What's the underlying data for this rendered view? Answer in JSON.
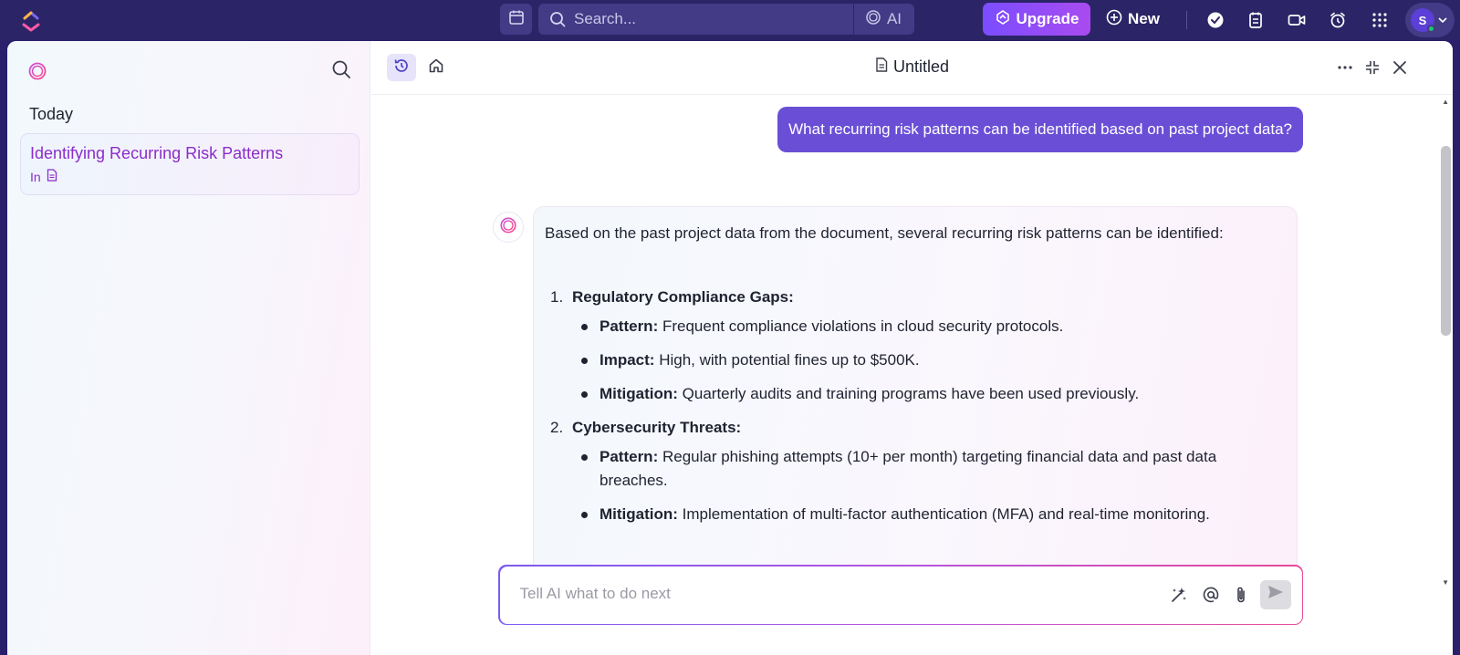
{
  "topbar": {
    "search_placeholder": "Search...",
    "ai_label": "AI",
    "upgrade_label": "Upgrade",
    "new_label": "New",
    "avatar_initial": "S"
  },
  "sidebar": {
    "section_today": "Today",
    "conversation": {
      "title": "Identifying Recurring Risk Patterns",
      "location_prefix": "In"
    }
  },
  "document": {
    "title": "Untitled"
  },
  "chat": {
    "user_message": "What recurring risk patterns can be identified based on past project data?",
    "ai_intro": "Based on the past project data from the document, several recurring risk patterns can be identified:",
    "items": [
      {
        "number": "1.",
        "heading": "Regulatory Compliance Gaps:",
        "bullets": [
          {
            "label": "Pattern:",
            "text": " Frequent compliance violations in cloud security protocols."
          },
          {
            "label": "Impact:",
            "text": " High, with potential fines up to $500K."
          },
          {
            "label": "Mitigation:",
            "text": " Quarterly audits and training programs have been used previously."
          }
        ]
      },
      {
        "number": "2.",
        "heading": "Cybersecurity Threats:",
        "bullets": [
          {
            "label": "Pattern:",
            "text": " Regular phishing attempts (10+ per month) targeting financial data and past data breaches."
          },
          {
            "label": "Mitigation:",
            "text": " Implementation of multi-factor authentication (MFA) and real-time monitoring."
          }
        ]
      }
    ]
  },
  "composer": {
    "placeholder": "Tell AI what to do next"
  },
  "colors": {
    "topbar_bg": "#2b2466",
    "accent": "#6a4fd6",
    "upgrade_gradient": [
      "#7b4dff",
      "#a94bf0"
    ],
    "conversation_text": "#8b2dc9"
  },
  "icons": [
    "clickup-logo-icon",
    "calendar-icon",
    "search-icon",
    "ai-brain-icon",
    "upgrade-icon",
    "plus-circle-icon",
    "check-circle-icon",
    "notepad-icon",
    "video-icon",
    "alarm-icon",
    "apps-grid-icon",
    "history-icon",
    "home-icon",
    "document-icon",
    "more-icon",
    "collapse-icon",
    "close-icon",
    "sparkle-icon",
    "at-icon",
    "attachment-icon",
    "send-icon"
  ]
}
